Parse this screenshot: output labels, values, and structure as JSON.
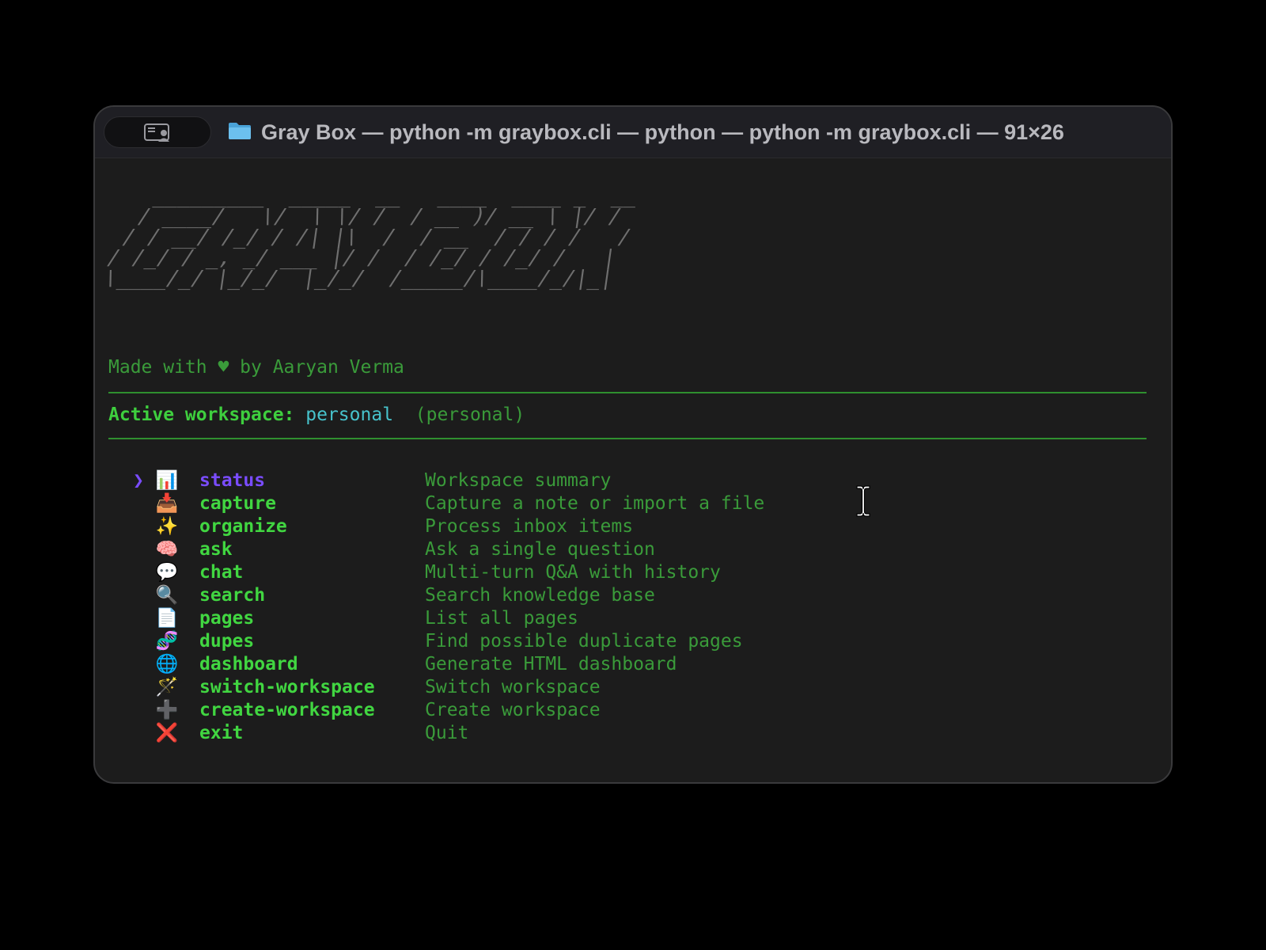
{
  "window": {
    "title": "Gray Box — python -m graybox.cli — python — python -m graybox.cli — 91×26"
  },
  "banner": {
    "ascii_art": "   _________  _____  __   ____  ____ _  __\n  / ____/   \\/  \\ \\/ /  / __ )/ __ \\ |/ /\n / / __/ /_/ / /| |\\  /  / __  / / / /   / \n/ /_/ / _, _/ ___ |/ /  / /_/ / /_/ /   |  \n\\____/_/ |_/_/  |_/_/  /_____/\\____/_/|_|  ",
    "credit": "Made with ♥ by Aaryan Verma"
  },
  "workspace": {
    "label": "Active workspace:",
    "name": "personal",
    "type": "(personal)"
  },
  "menu": {
    "pointer": "❯",
    "items": [
      {
        "icon": "📊",
        "command": "status",
        "description": "Workspace summary"
      },
      {
        "icon": "📥",
        "command": "capture",
        "description": "Capture a note or import a file"
      },
      {
        "icon": "✨",
        "command": "organize",
        "description": "Process inbox items"
      },
      {
        "icon": "🧠",
        "command": "ask",
        "description": "Ask a single question"
      },
      {
        "icon": "💬",
        "command": "chat",
        "description": "Multi-turn Q&A with history"
      },
      {
        "icon": "🔍",
        "command": "search",
        "description": "Search knowledge base"
      },
      {
        "icon": "📄",
        "command": "pages",
        "description": "List all pages"
      },
      {
        "icon": "🧬",
        "command": "dupes",
        "description": "Find possible duplicate pages"
      },
      {
        "icon": "🌐",
        "command": "dashboard",
        "description": "Generate HTML dashboard"
      },
      {
        "icon": "🪄",
        "command": "switch-workspace",
        "description": "Switch workspace"
      },
      {
        "icon": "➕",
        "command": "create-workspace",
        "description": "Create workspace"
      },
      {
        "icon": "❌",
        "command": "exit",
        "description": "Quit"
      }
    ]
  },
  "colors": {
    "selected": "#7a4cff",
    "command": "#41d641",
    "description": "#3a9b3a",
    "workspace_name": "#47c3cc"
  }
}
